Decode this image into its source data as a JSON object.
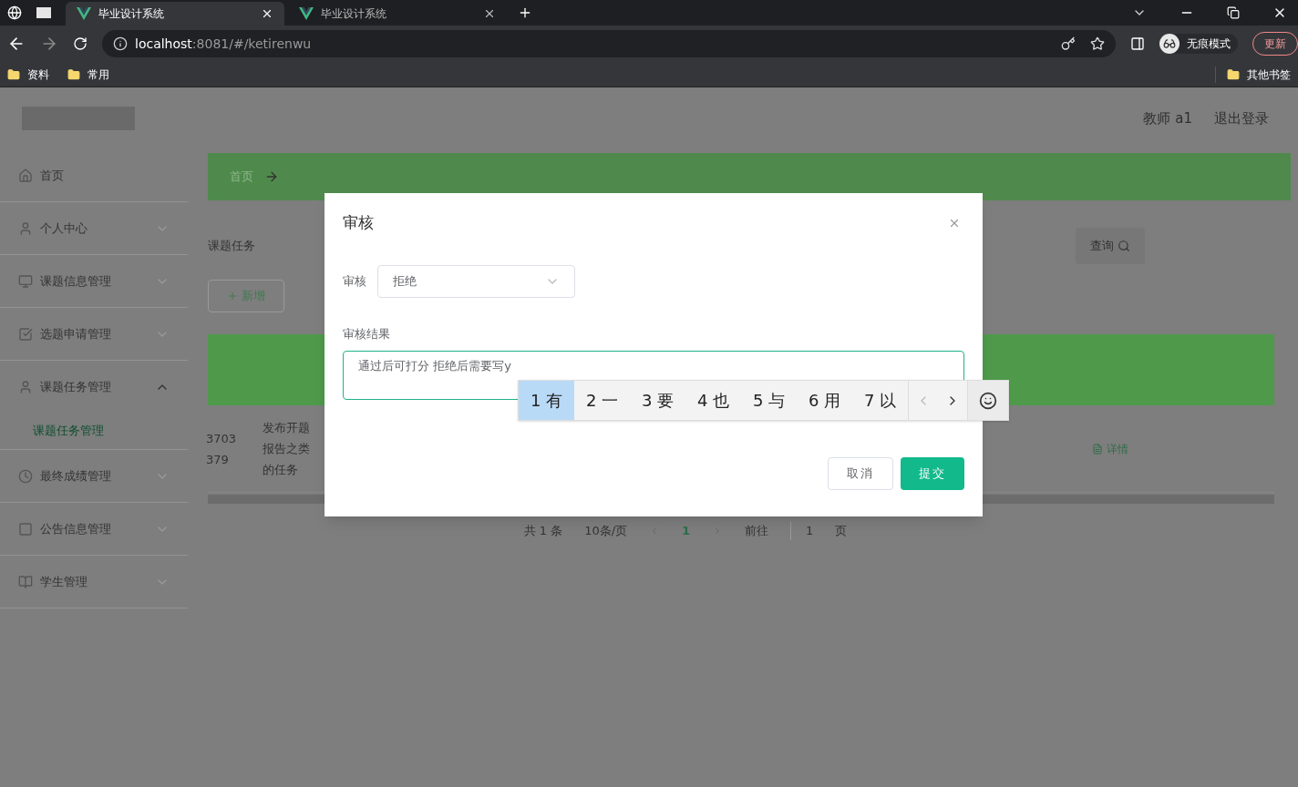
{
  "browser": {
    "tabs": [
      {
        "title": "毕业设计系统",
        "selected": true
      },
      {
        "title": "毕业设计系统",
        "selected": false
      }
    ],
    "url": {
      "host": "localhost",
      "rest": ":8081/#/ketirenwu"
    },
    "profile_label": "无痕模式",
    "update_button": "更新",
    "bookmarks": [
      "资料",
      "常用"
    ],
    "other_bookmarks": "其他书签"
  },
  "header": {
    "user": "教师 a1",
    "logout": "退出登录"
  },
  "sidebar": {
    "items": [
      {
        "label": "首页",
        "kind": "home"
      },
      {
        "label": "个人中心",
        "kind": "user",
        "expanded": false
      },
      {
        "label": "课题信息管理",
        "kind": "monitor",
        "expanded": false
      },
      {
        "label": "选题申请管理",
        "kind": "check",
        "expanded": false
      },
      {
        "label": "课题任务管理",
        "kind": "user",
        "expanded": true,
        "children": [
          {
            "label": "课题任务管理",
            "selected": true
          }
        ]
      },
      {
        "label": "最终成绩管理",
        "kind": "clock",
        "expanded": false
      },
      {
        "label": "公告信息管理",
        "kind": "square",
        "expanded": false
      },
      {
        "label": "学生管理",
        "kind": "book",
        "expanded": false
      }
    ]
  },
  "breadcrumb": [
    "首页"
  ],
  "search": {
    "label": "课题任务",
    "button": "查询"
  },
  "add_button": "新增",
  "table": {
    "rows": [
      {
        "cells": [
          [
            "3703",
            "379"
          ],
          [
            "发布开题",
            "报告之类",
            "的任务"
          ]
        ],
        "actions": [
          "详情"
        ]
      }
    ]
  },
  "pagination": {
    "total": "共 1 条",
    "page_size": "10条/页",
    "pages": [
      {
        "label": "1",
        "selected": true
      }
    ],
    "goto_label": "前往",
    "goto_value": "1",
    "goto_suffix": "页"
  },
  "dialog": {
    "title": "审核",
    "select": {
      "label": "审核",
      "value": "拒绝"
    },
    "textarea": {
      "label": "审核结果",
      "value": "通过后可打分 拒绝后需要写y"
    },
    "buttons": [
      {
        "label": "取消",
        "kind": "default"
      },
      {
        "label": "提交",
        "kind": "primary"
      }
    ]
  },
  "ime": {
    "candidates": [
      {
        "label": "1 有",
        "selected": true
      },
      {
        "label": "2 一",
        "selected": false
      },
      {
        "label": "3 要",
        "selected": false
      },
      {
        "label": "4 也",
        "selected": false
      },
      {
        "label": "5 与",
        "selected": false
      },
      {
        "label": "6 用",
        "selected": false
      },
      {
        "label": "7 以",
        "selected": false
      }
    ]
  }
}
